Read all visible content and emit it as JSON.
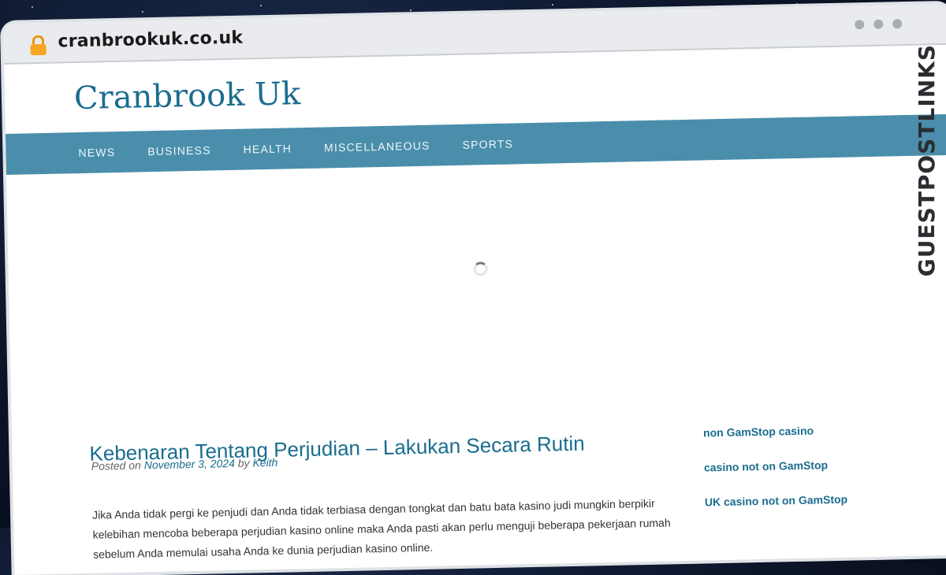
{
  "browser": {
    "url": "cranbrookuk.co.uk"
  },
  "site": {
    "title": "Cranbrook Uk",
    "nav": [
      "NEWS",
      "BUSINESS",
      "HEALTH",
      "MISCELLANEOUS",
      "SPORTS"
    ]
  },
  "post": {
    "title": "Kebenaran Tentang Perjudian – Lakukan Secara Rutin",
    "posted_on_label": "Posted on",
    "date": "November 3, 2024",
    "by_label": "by",
    "author": "Keith",
    "excerpt": "Jika Anda tidak pergi ke penjudi dan Anda tidak terbiasa dengan tongkat dan batu bata kasino judi mungkin berpikir kelebihan mencoba beberapa perjudian kasino online maka Anda pasti akan perlu menguji beberapa pekerjaan rumah sebelum Anda memulai usaha Anda ke dunia perjudian kasino online."
  },
  "sidebar": {
    "links": [
      "non GamStop casino",
      "casino not on GamStop",
      "UK casino not on GamStop"
    ]
  },
  "watermark": {
    "text": "GUESTPOSTLINKS"
  },
  "colors": {
    "accent": "#1a6d8f",
    "nav_bg": "#4a8eab",
    "lock": "#f5a623",
    "watermark_chain": "#f0643c"
  }
}
